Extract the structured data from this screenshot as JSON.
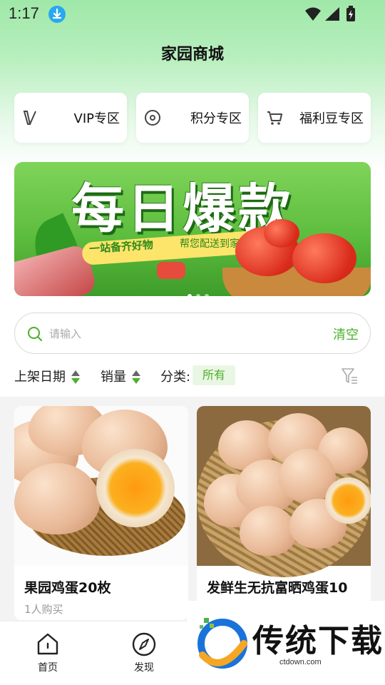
{
  "status": {
    "time": "1:17"
  },
  "header": {
    "title": "家园商城"
  },
  "zones": [
    {
      "label": "VIP专区",
      "icon": "vip-icon"
    },
    {
      "label": "积分专区",
      "icon": "points-icon"
    },
    {
      "label": "福利豆专区",
      "icon": "cart-icon"
    }
  ],
  "banner": {
    "headline": "每日爆款",
    "slogan": "一站备齐好物",
    "slogan2": "帮您配送到家"
  },
  "search": {
    "placeholder": "请输入",
    "clear_label": "清空"
  },
  "filters": {
    "date_label": "上架日期",
    "sales_label": "销量",
    "category_label": "分类:",
    "category_value": "所有"
  },
  "products": [
    {
      "name": "果园鸡蛋20枚",
      "buyers": "1人购买"
    },
    {
      "name": "发鲜生无抗富晒鸡蛋10",
      "buyers": ""
    }
  ],
  "nav": [
    {
      "label": "首页",
      "icon": "home-icon"
    },
    {
      "label": "发现",
      "icon": "compass-icon"
    }
  ],
  "watermark": {
    "text": "传统下载",
    "url": "ctdown.com"
  },
  "colors": {
    "accent": "#4caf2a",
    "header_green": "#9fe8a8"
  }
}
